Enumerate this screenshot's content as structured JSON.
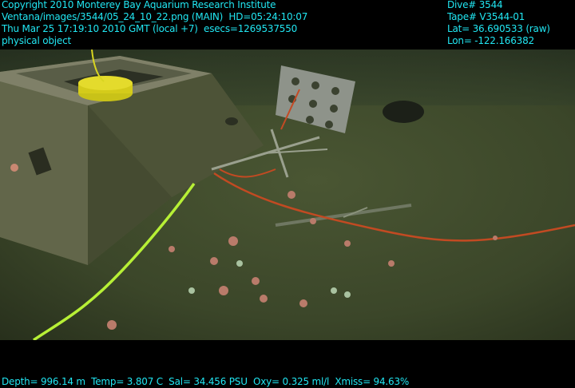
{
  "overlay": {
    "top_left": [
      "Copyright 2010 Monterey Bay Aquarium Research Institute",
      "Ventana/images/3544/05_24_10_22.png (MAIN)  HD=05:24:10:07",
      "Thu Mar 25 17:19:10 2010 GMT (local +7)  esecs=1269537550",
      "physical object"
    ],
    "top_right": [
      "Dive# 3544",
      "Tape# V3544-01",
      "Lat= 36.690533 (raw)",
      "Lon= -122.166382"
    ],
    "bottom": "Depth= 996.14 m  Temp= 3.807 C  Sal= 34.456 PSU  Oxy= 0.325 ml/l  Xmiss= 94.63%",
    "color": "#21e6f2"
  },
  "scene": {
    "background_color": "#3e4a2c",
    "cable_color": "#b7f036",
    "hose_color": "#c24a22"
  }
}
